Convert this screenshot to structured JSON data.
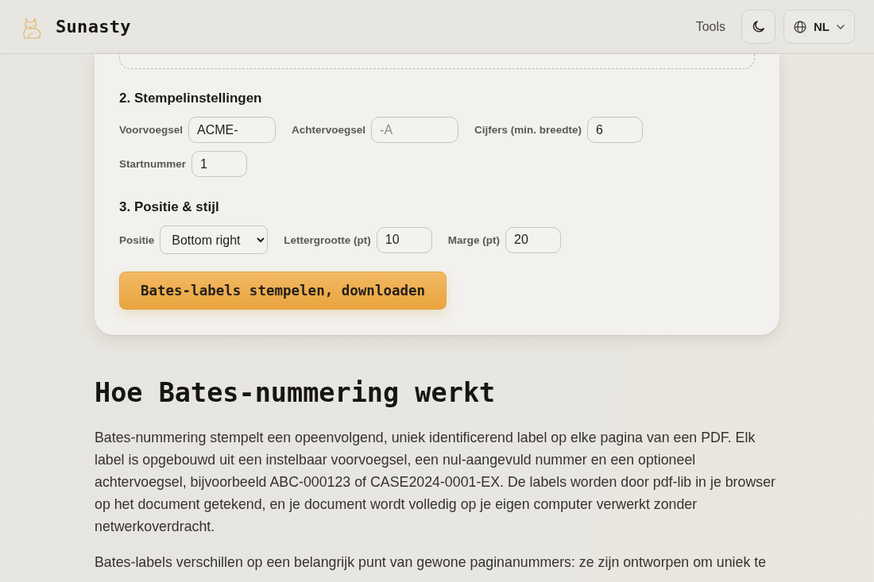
{
  "header": {
    "brand": "Sunasty",
    "nav": [
      {
        "label": "Tools"
      }
    ],
    "language": "NL"
  },
  "tool_card": {
    "sections": [
      {
        "title": "2. Stempelinstellingen",
        "fields": [
          {
            "kind": "text",
            "label": "Voorvoegsel",
            "value": "ACME-"
          },
          {
            "kind": "text",
            "label": "Achtervoegsel",
            "placeholder": "-A"
          },
          {
            "kind": "number",
            "label": "Cijfers (min. breedte)",
            "value": "6"
          },
          {
            "kind": "number",
            "label": "Startnummer",
            "value": "1"
          }
        ]
      },
      {
        "title": "3. Positie & stijl",
        "fields": [
          {
            "kind": "select",
            "label": "Positie",
            "value": "Bottom right"
          },
          {
            "kind": "number",
            "label": "Lettergrootte (pt)",
            "value": "10"
          },
          {
            "kind": "number",
            "label": "Marge (pt)",
            "value": "20"
          }
        ]
      }
    ],
    "submit_button": "Bates-labels stempelen, downloaden"
  },
  "article": {
    "heading": "Hoe Bates-nummering werkt",
    "paragraphs": [
      "Bates-nummering stempelt een opeenvolgend, uniek identificerend label op elke pagina van een PDF. Elk label is opgebouwd uit een instelbaar voorvoegsel, een nul-aangevuld nummer en een optioneel achtervoegsel, bijvoorbeeld ABC-000123 of CASE2024-0001-EX. De labels worden door pdf-lib in je browser op het document getekend, en je document wordt volledig op je eigen computer verwerkt zonder netwerkoverdracht.",
      "Bates-labels verschillen op een belangrijk punt van gewone paginanummers: ze zijn ontworpen om uniek te"
    ]
  }
}
